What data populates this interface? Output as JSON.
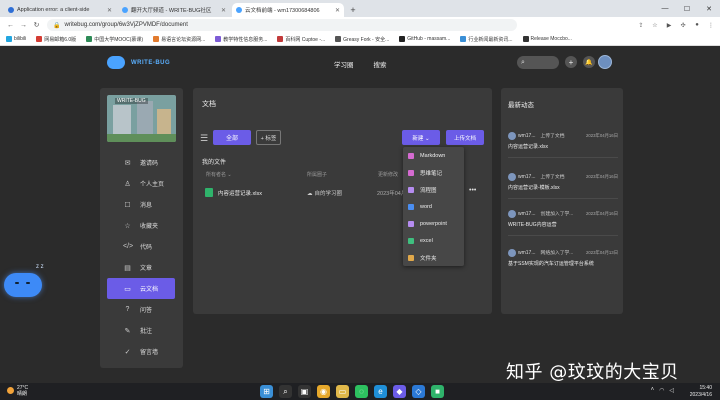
{
  "browser": {
    "tabs": [
      {
        "title": "Application error: a client-side",
        "color": "#2f6fd6"
      },
      {
        "title": "翻开大厅频道 - WRITE-BUG社区",
        "color": "#4aa3ff"
      },
      {
        "title": "云文档前端 - wm17300684806",
        "color": "#4aa3ff"
      }
    ],
    "url": "writebug.com/group/6w3VjZPVMDF/document",
    "bookmarks": [
      {
        "label": "bilibili",
        "color": "#22a6e0"
      },
      {
        "label": "网易邮箱6.0版",
        "color": "#d43c33"
      },
      {
        "label": "中国大学MOOC(慕课)",
        "color": "#2e8b57"
      },
      {
        "label": "易语言论坛资源网...",
        "color": "#e27b2e"
      },
      {
        "label": "教学特性信息服务...",
        "color": "#7d5cd6"
      },
      {
        "label": "百科网 Cuptoe -...",
        "color": "#c23b3b"
      },
      {
        "label": "Greasy Fork - 安全...",
        "color": "#555555"
      },
      {
        "label": "GitHub - massam...",
        "color": "#222222"
      },
      {
        "label": "行业新闻最新资讯...",
        "color": "#3a8fd6"
      },
      {
        "label": "Release Moccbo...",
        "color": "#333333"
      }
    ]
  },
  "header": {
    "logo_text": "WRITE-BUG",
    "nav": [
      "学习圈",
      "搜索"
    ]
  },
  "sidebar": {
    "profile_tag": "WRITE-BUG",
    "items": [
      {
        "label": "邀请码",
        "icon": "✉"
      },
      {
        "label": "个人主页",
        "icon": "♙"
      },
      {
        "label": "消息",
        "icon": "☐"
      },
      {
        "label": "收藏夹",
        "icon": "☆"
      },
      {
        "label": "代码",
        "icon": "<>"
      },
      {
        "label": "文章",
        "icon": "▤"
      },
      {
        "label": "云文档",
        "icon": "▭",
        "active": true
      },
      {
        "label": "问答",
        "icon": "?"
      },
      {
        "label": "批注",
        "icon": "✎"
      },
      {
        "label": "留言墙",
        "icon": "✓"
      }
    ]
  },
  "main": {
    "title": "文档",
    "toolbar": {
      "all": "全部",
      "tag": "+ 标签",
      "new": "新建 ⌄",
      "upload": "上传文档"
    },
    "section": "我的文件",
    "columns": [
      "所有者名 ⌄",
      "所属圈子",
      "更新修改"
    ],
    "rows": [
      {
        "name": "内容运营记录.xlsx",
        "owner": "自的学习圈",
        "date": "2023年04月...",
        "more": "•••"
      }
    ]
  },
  "dropdown": {
    "items": [
      {
        "label": "Markdown",
        "color": "#d56bd1"
      },
      {
        "label": "思维笔记",
        "color": "#d56bd1"
      },
      {
        "label": "流程图",
        "color": "#b58cf0"
      },
      {
        "label": "word",
        "color": "#4a8ef2"
      },
      {
        "label": "powerpoint",
        "color": "#b58cf0"
      },
      {
        "label": "excel",
        "color": "#3fbf7f"
      },
      {
        "label": "文件夹",
        "color": "#e0a84a"
      }
    ]
  },
  "activity": {
    "title": "最新动态",
    "items": [
      {
        "user": "wm17...",
        "action": "上传了文档",
        "time": "2023年04月16日",
        "doc": "内容运营记录.xlsx"
      },
      {
        "user": "wm17...",
        "action": "上传了文档",
        "time": "2023年04月16日",
        "doc": "内容运营记录-模板.xlsx"
      },
      {
        "user": "wm17...",
        "action": "创建加入了学...",
        "time": "2023年04月16日",
        "doc": "WRITE-BUG内容运营"
      },
      {
        "user": "wm17...",
        "action": "网络加入了学...",
        "time": "2023年04月13日",
        "doc": "基于SSM实现的汽车订运管理平台系统"
      }
    ]
  },
  "watermark": "知乎 @玟玟的大宝贝",
  "taskbar": {
    "temp": "27°C",
    "weather": "晴朗",
    "time": "15:40",
    "date": "2023/4/16"
  }
}
